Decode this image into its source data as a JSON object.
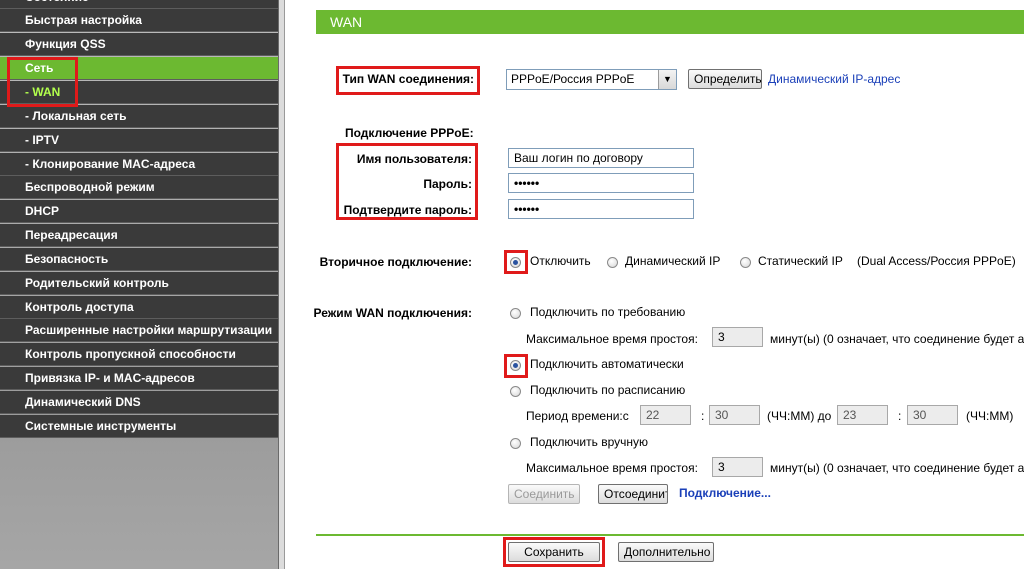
{
  "sidebar": {
    "items": [
      {
        "label": "Состояние",
        "state": "normal"
      },
      {
        "label": "Быстрая настройка",
        "state": "normal"
      },
      {
        "label": "Функция QSS",
        "state": "normal"
      },
      {
        "label": "Сеть",
        "state": "active"
      },
      {
        "label": "- WAN",
        "state": "active-sub"
      },
      {
        "label": "- Локальная сеть",
        "state": "sub"
      },
      {
        "label": "- IPTV",
        "state": "sub"
      },
      {
        "label": "- Клонирование MAC-адреса",
        "state": "sub"
      },
      {
        "label": "Беспроводной режим",
        "state": "normal"
      },
      {
        "label": "DHCP",
        "state": "normal"
      },
      {
        "label": "Переадресация",
        "state": "normal"
      },
      {
        "label": "Безопасность",
        "state": "normal"
      },
      {
        "label": "Родительский контроль",
        "state": "normal"
      },
      {
        "label": "Контроль доступа",
        "state": "normal"
      },
      {
        "label": "Расширенные настройки маршрутизации",
        "state": "normal"
      },
      {
        "label": "Контроль пропускной способности",
        "state": "normal"
      },
      {
        "label": "Привязка IP- и MAC-адресов",
        "state": "normal"
      },
      {
        "label": "Динамический DNS",
        "state": "normal"
      },
      {
        "label": "Системные инструменты",
        "state": "normal"
      }
    ]
  },
  "header": {
    "title": "WAN"
  },
  "wan_type": {
    "label": "Тип WAN соединения:",
    "selected": "PPPoE/Россия PPPoE",
    "detect_button": "Определить",
    "dynamic_link": "Динамический IP-адрес"
  },
  "pppoe": {
    "section_label": "Подключение PPPoE:",
    "username_label": "Имя пользователя:",
    "username_value": "Ваш логин по договору",
    "password_label": "Пароль:",
    "password_value": "••••••",
    "confirm_label": "Подтвердите пароль:",
    "confirm_value": "••••••"
  },
  "secondary": {
    "label": "Вторичное подключение:",
    "options": [
      "Отключить",
      "Динамический IP",
      "Статический IP"
    ],
    "note": "(Dual Access/Россия PPPoE)"
  },
  "mode": {
    "label": "Режим WAN подключения:",
    "on_demand": "Подключить по требованию",
    "max_idle_label": "Максимальное время простоя:",
    "max_idle_value": "3",
    "idle_suffix": "минут(ы) (0 означает, что соединение будет а",
    "auto": "Подключить автоматически",
    "schedule": "Подключить по расписанию",
    "period_label": "Период времени:с",
    "from_h": "22",
    "from_m": "30",
    "hhmm_to": "(ЧЧ:ММ) до",
    "to_h": "23",
    "to_m": "30",
    "hhmm": "(ЧЧ:ММ)",
    "colon": ":",
    "manual": "Подключить вручную",
    "max_idle_label2": "Максимальное время простоя:",
    "max_idle_value2": "3",
    "idle_suffix2": "минут(ы) (0 означает, что соединение будет а",
    "connect_button": "Соединить",
    "disconnect_button": "Отсоединить",
    "status_link": "Подключение..."
  },
  "footer": {
    "save_button": "Сохранить",
    "advanced_button": "Дополнительно"
  },
  "colors": {
    "accent": "#6cb931",
    "highlight": "#e01a1a",
    "sidebar_item": "#3a3a3a"
  }
}
